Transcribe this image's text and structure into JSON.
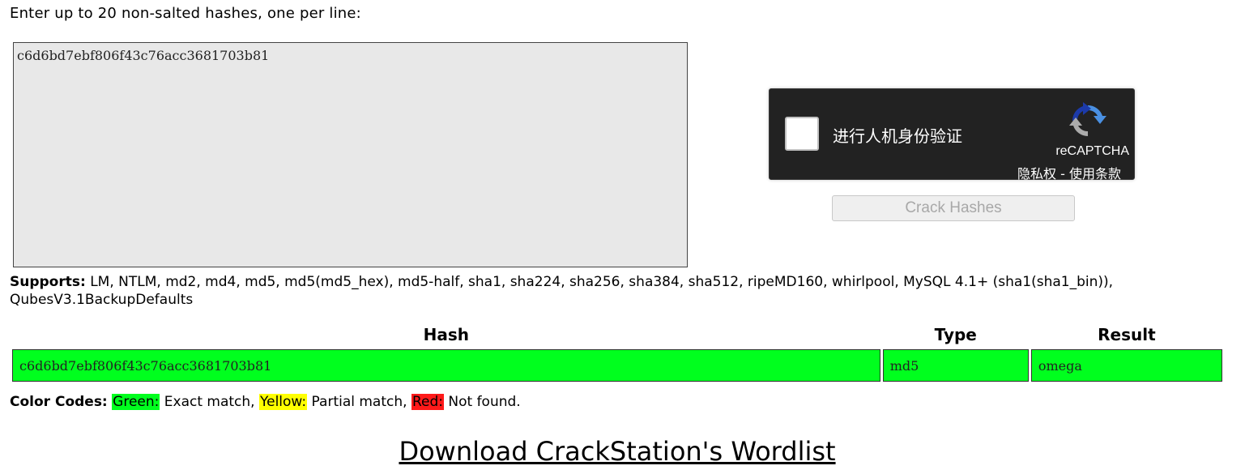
{
  "prompt": "Enter up to 20 non-salted hashes, one per line:",
  "hash_input": {
    "value": "c6d6bd7ebf806f43c76acc3681703b81"
  },
  "recaptcha": {
    "label": "进行人机身份验证",
    "brand": "reCAPTCHA",
    "privacy": "隐私权",
    "separator": " - ",
    "terms": "使用条款",
    "logo_icon": "recaptcha-logo-icon"
  },
  "crack_button": "Crack Hashes",
  "supports": {
    "label": "Supports:",
    "text": " LM, NTLM, md2, md4, md5, md5(md5_hex), md5-half, sha1, sha224, sha256, sha384, sha512, ripeMD160, whirlpool, MySQL 4.1+ (sha1(sha1_bin)), QubesV3.1BackupDefaults"
  },
  "results": {
    "headers": [
      "Hash",
      "Type",
      "Result"
    ],
    "rows": [
      {
        "hash": "c6d6bd7ebf806f43c76acc3681703b81",
        "type": "md5",
        "result": "omega",
        "status_color": "#00ff1e"
      }
    ]
  },
  "color_codes": {
    "label": "Color Codes:",
    "green": "Green:",
    "green_desc": " Exact match, ",
    "yellow": "Yellow:",
    "yellow_desc": " Partial match, ",
    "red": "Red:",
    "red_desc": " Not found.",
    "colors": {
      "green": "#00ff1e",
      "yellow": "#ffff00",
      "red": "#ff1a1a"
    }
  },
  "download_link": "Download CrackStation's Wordlist"
}
